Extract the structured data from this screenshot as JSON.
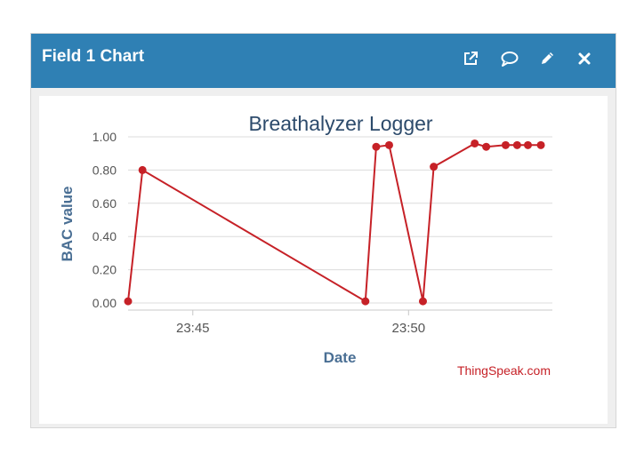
{
  "header": {
    "title": "Field 1 Chart",
    "buttons": [
      {
        "icon": "external-link-icon"
      },
      {
        "icon": "comment-icon"
      },
      {
        "icon": "pencil-icon"
      },
      {
        "icon": "close-icon"
      }
    ]
  },
  "colors": {
    "header_bg": "#2f80b4",
    "series": "#c62127",
    "axis_label": "#4a6f94",
    "title": "#2c4a6b",
    "credit": "#c62127"
  },
  "credit": "ThingSpeak.com",
  "chart_data": {
    "type": "line",
    "title": "Breathalyzer Logger",
    "xlabel": "Date",
    "ylabel": "BAC value",
    "ylim": [
      0,
      1.0
    ],
    "yticks": [
      "0.00",
      "0.20",
      "0.40",
      "0.60",
      "0.80",
      "1.00"
    ],
    "xticks": [
      "23:45",
      "23:50"
    ],
    "xlim": [
      "23:43:30",
      "23:53:20"
    ],
    "grid": true,
    "series": [
      {
        "x": [
          "23:43:30",
          "23:43:50",
          "23:49:00",
          "23:49:15",
          "23:49:33",
          "23:50:20",
          "23:50:35",
          "23:51:32",
          "23:51:48",
          "23:52:15",
          "23:52:31",
          "23:52:46",
          "23:53:04"
        ],
        "y": [
          0.01,
          0.8,
          0.01,
          0.94,
          0.95,
          0.01,
          0.82,
          0.96,
          0.94,
          0.95,
          0.95,
          0.95,
          0.95
        ]
      }
    ]
  }
}
